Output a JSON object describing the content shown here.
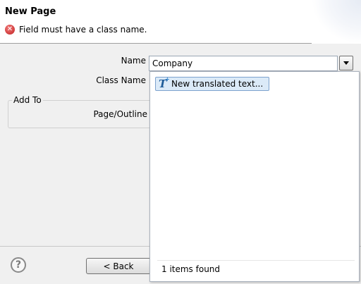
{
  "header": {
    "title": "New Page",
    "error_message": "Field must have a class name."
  },
  "form": {
    "name_label": "Name",
    "name_value": "Company",
    "class_name_label": "Class Name",
    "group_title": "Add To",
    "page_outline_label": "Page/Outline"
  },
  "popup": {
    "items": [
      {
        "label": "New translated text...",
        "icon": "translated-text-icon"
      }
    ],
    "status": "1 items found"
  },
  "footer": {
    "back_label": "< Back",
    "help_icon": "help-icon"
  },
  "colors": {
    "error": "#c01e1e",
    "selection_bg": "#dbeaf8",
    "selection_border": "#7da2ce"
  }
}
